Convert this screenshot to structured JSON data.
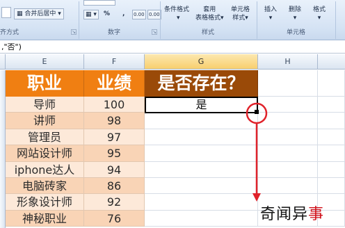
{
  "ribbon": {
    "merge_center": "合并后居中",
    "percent": "%",
    "comma": ",",
    "decimal": "0.00",
    "conditional_format": "条件格式",
    "table_format_top": "套用",
    "table_format_bottom": "表格格式",
    "cell_style_top": "单元格",
    "cell_style_bottom": "样式",
    "insert": "插入",
    "delete": "删除",
    "format": "格式",
    "group_alignment": "齐方式",
    "group_number": "数字",
    "group_styles": "样式",
    "group_cells": "单元格"
  },
  "formula_bar": {
    "text": ",\"否\")"
  },
  "columns": [
    "E",
    "F",
    "G",
    "H"
  ],
  "table": {
    "headers": {
      "occupation": "职业",
      "performance": "业绩",
      "exists": "是否存在？"
    },
    "rows": [
      {
        "occupation": "导师",
        "score": "100"
      },
      {
        "occupation": "讲师",
        "score": "98"
      },
      {
        "occupation": "管理员",
        "score": "97"
      },
      {
        "occupation": "网站设计师",
        "score": "95"
      },
      {
        "occupation": "iphone达人",
        "score": "94"
      },
      {
        "occupation": "电脑砖家",
        "score": "86"
      },
      {
        "occupation": "形象设计师",
        "score": "92"
      },
      {
        "occupation": "神秘职业",
        "score": "76"
      }
    ],
    "result": "是"
  },
  "watermark": {
    "part1": "奇闻异",
    "part2": "事"
  },
  "colors": {
    "header_orange": "#f07f12",
    "header_brown": "#9a4a08",
    "row_light": "#fde9d9",
    "row_dark": "#f9d4b6",
    "annotation_red": "#e0222a"
  }
}
